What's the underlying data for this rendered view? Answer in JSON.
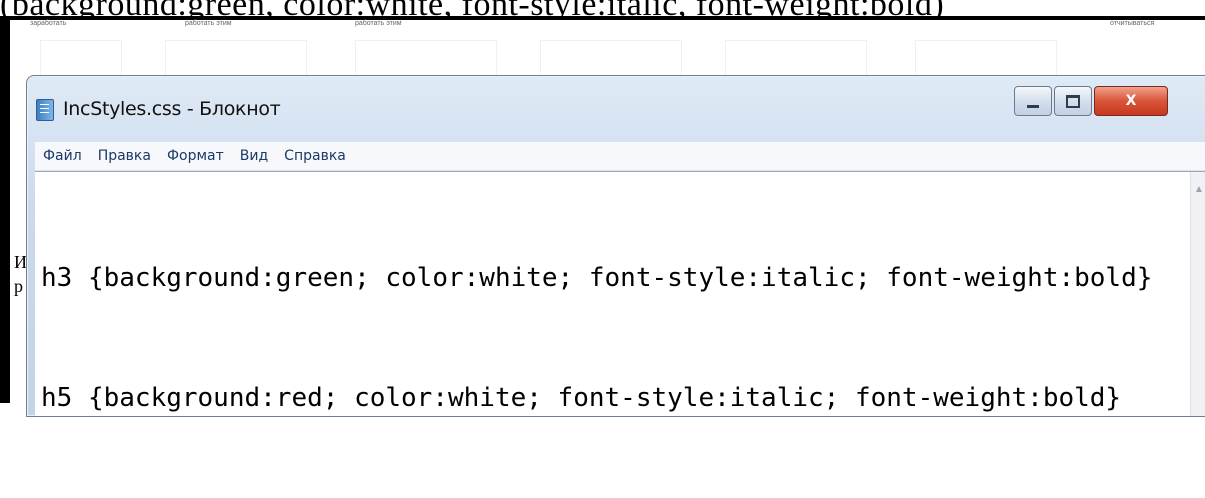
{
  "background_doc": {
    "top_text": "(background:green, color:white, font-style:italic, font-weight:bold)",
    "tiny_labels": [
      "заработать",
      "работать этим",
      "работать этим",
      "отчитываться"
    ],
    "side_glyphs": [
      "И",
      "р"
    ]
  },
  "window": {
    "title": "IncStyles.css - Блокнот",
    "app_icon": "notepad-icon",
    "controls": {
      "minimize": "minimize-icon",
      "maximize": "maximize-icon",
      "close_label": "X"
    },
    "menu": [
      "Файл",
      "Правка",
      "Формат",
      "Вид",
      "Справка"
    ],
    "editor": {
      "lines": [
        "h3 {background:green; color:white; font-style:italic; font-weight:bold}",
        "h5 {background:red; color:white; font-style:italic; font-weight:bold}"
      ]
    },
    "scrollbar": {
      "up_icon": "scroll-up-arrow-icon"
    }
  },
  "colors": {
    "close_button": "#d9553a",
    "titlebar": "#cad9ec",
    "menu_text": "#1b3a66"
  }
}
